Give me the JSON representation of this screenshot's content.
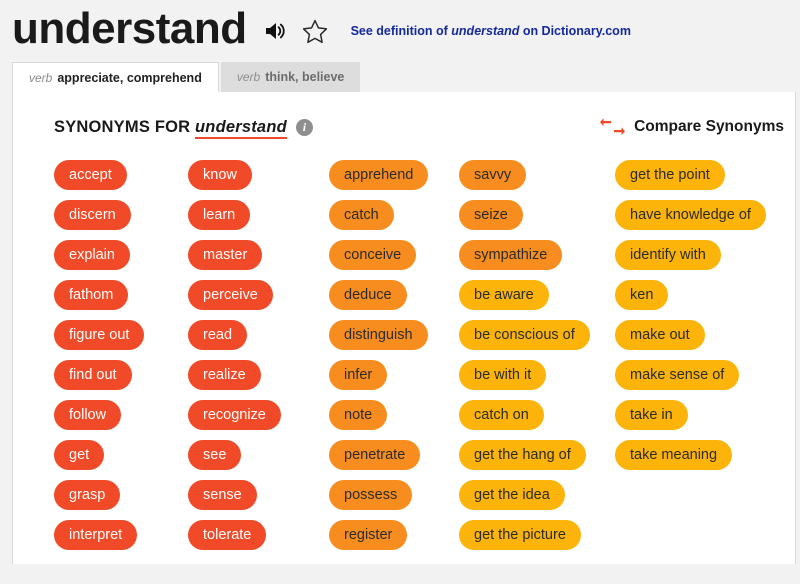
{
  "header": {
    "entry_word": "understand",
    "speaker_icon": "speaker-icon",
    "star_icon": "star-outline-icon",
    "definition_link_prefix": "See definition of ",
    "definition_link_word": "understand",
    "definition_link_suffix": " on Dictionary.com"
  },
  "tabs": [
    {
      "pos": "verb",
      "label": "appreciate, comprehend",
      "active": true
    },
    {
      "pos": "verb",
      "label": "think, believe",
      "active": false
    }
  ],
  "synonyms_header": {
    "prefix": "SYNONYMS FOR ",
    "word": "understand",
    "info_icon": "info-icon"
  },
  "compare": {
    "icon": "compare-arrows-icon",
    "label": "Compare Synonyms"
  },
  "colors": {
    "strength_5": "#f04a28",
    "strength_4": "#f78d1e",
    "strength_3": "#fcb40b",
    "link": "#14299c",
    "page_background": "#f2f2f2",
    "panel_background": "#ffffff"
  },
  "columns": [
    {
      "chips": [
        {
          "label": "accept",
          "strength": 5
        },
        {
          "label": "discern",
          "strength": 5
        },
        {
          "label": "explain",
          "strength": 5
        },
        {
          "label": "fathom",
          "strength": 5
        },
        {
          "label": "figure out",
          "strength": 5
        },
        {
          "label": "find out",
          "strength": 5
        },
        {
          "label": "follow",
          "strength": 5
        },
        {
          "label": "get",
          "strength": 5
        },
        {
          "label": "grasp",
          "strength": 5
        },
        {
          "label": "interpret",
          "strength": 5
        }
      ]
    },
    {
      "chips": [
        {
          "label": "know",
          "strength": 5
        },
        {
          "label": "learn",
          "strength": 5
        },
        {
          "label": "master",
          "strength": 5
        },
        {
          "label": "perceive",
          "strength": 5
        },
        {
          "label": "read",
          "strength": 5
        },
        {
          "label": "realize",
          "strength": 5
        },
        {
          "label": "recognize",
          "strength": 5
        },
        {
          "label": "see",
          "strength": 5
        },
        {
          "label": "sense",
          "strength": 5
        },
        {
          "label": "tolerate",
          "strength": 5
        }
      ]
    },
    {
      "chips": [
        {
          "label": "apprehend",
          "strength": 4
        },
        {
          "label": "catch",
          "strength": 4
        },
        {
          "label": "conceive",
          "strength": 4
        },
        {
          "label": "deduce",
          "strength": 4
        },
        {
          "label": "distinguish",
          "strength": 4
        },
        {
          "label": "infer",
          "strength": 4
        },
        {
          "label": "note",
          "strength": 4
        },
        {
          "label": "penetrate",
          "strength": 4
        },
        {
          "label": "possess",
          "strength": 4
        },
        {
          "label": "register",
          "strength": 4
        }
      ]
    },
    {
      "chips": [
        {
          "label": "savvy",
          "strength": 4
        },
        {
          "label": "seize",
          "strength": 4
        },
        {
          "label": "sympathize",
          "strength": 4
        },
        {
          "label": "be aware",
          "strength": 3
        },
        {
          "label": "be conscious of",
          "strength": 3
        },
        {
          "label": "be with it",
          "strength": 3
        },
        {
          "label": "catch on",
          "strength": 3
        },
        {
          "label": "get the hang of",
          "strength": 3
        },
        {
          "label": "get the idea",
          "strength": 3
        },
        {
          "label": "get the picture",
          "strength": 3
        }
      ]
    },
    {
      "chips": [
        {
          "label": "get the point",
          "strength": 3
        },
        {
          "label": "have knowledge of",
          "strength": 3
        },
        {
          "label": "identify with",
          "strength": 3
        },
        {
          "label": "ken",
          "strength": 3
        },
        {
          "label": "make out",
          "strength": 3
        },
        {
          "label": "make sense of",
          "strength": 3
        },
        {
          "label": "take in",
          "strength": 3
        },
        {
          "label": "take meaning",
          "strength": 3
        }
      ]
    }
  ]
}
